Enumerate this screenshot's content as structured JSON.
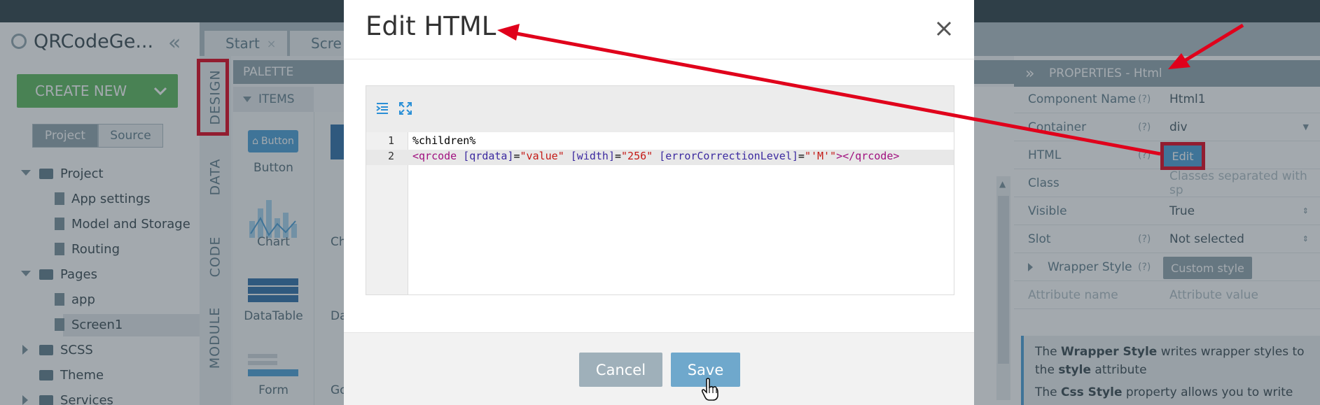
{
  "sidebar": {
    "project_name": "QRCodeGe...",
    "create_new_label": "CREATE NEW",
    "segments": [
      "Project",
      "Source"
    ],
    "tree": [
      {
        "label": "Project",
        "type": "folder"
      },
      {
        "label": "App settings",
        "type": "settings"
      },
      {
        "label": "Model and Storage",
        "type": "settings"
      },
      {
        "label": "Routing",
        "type": "settings"
      },
      {
        "label": "Pages",
        "type": "folder"
      },
      {
        "label": "app",
        "type": "page"
      },
      {
        "label": "Screen1",
        "type": "page"
      },
      {
        "label": "SCSS",
        "type": "folder"
      },
      {
        "label": "Theme",
        "type": "folder"
      },
      {
        "label": "Services",
        "type": "folder"
      }
    ]
  },
  "tabs": [
    "Start",
    "Scre"
  ],
  "side_tabs": [
    "DESIGN",
    "DATA",
    "CODE",
    "MODULE"
  ],
  "palette": {
    "title": "PALETTE",
    "section": "ITEMS",
    "items": [
      "Button",
      "Chart",
      "DataTable",
      "Form"
    ],
    "partial_items": [
      "Ch",
      "Da",
      "Goo"
    ],
    "button_preview": "Button"
  },
  "properties": {
    "title": "PROPERTIES - Html",
    "rows": [
      {
        "key": "Component Name",
        "help": "(?)",
        "value": "Html1"
      },
      {
        "key": "Container",
        "help": "(?)",
        "value": "div"
      },
      {
        "key": "HTML",
        "help": "(?)",
        "value": "Edit"
      },
      {
        "key": "Class",
        "help": "",
        "value": "Classes separated with sp"
      },
      {
        "key": "Visible",
        "help": "",
        "value": "True"
      },
      {
        "key": "Slot",
        "help": "(?)",
        "value": "Not selected"
      },
      {
        "key": "Wrapper Style",
        "help": "(?)",
        "value": "Custom style"
      },
      {
        "key": "Attribute name",
        "help": "",
        "value": "Attribute value"
      }
    ],
    "info_line1_pre": "The ",
    "info_line1_bold": "Wrapper Style",
    "info_line1_post": " writes wrapper styles to",
    "info_line2_pre": "the ",
    "info_line2_bold": "style",
    "info_line2_post": " attribute",
    "info_line3_pre": "The ",
    "info_line3_bold": "Css Style",
    "info_line3_post": " property allows you to write css"
  },
  "modal": {
    "title": "Edit HTML",
    "close": "×",
    "line_numbers": [
      "1",
      "2"
    ],
    "code_line1": "%children%",
    "code_line2": {
      "t1": "<qrcode ",
      "t2": "[qrdata]",
      "t3": "=",
      "t4": "\"value\"",
      "t5": " ",
      "t6": "[width]",
      "t7": "=",
      "t8": "\"256\"",
      "t9": " ",
      "t10": "[errorCorrectionLevel]",
      "t11": "=",
      "t12": "\"'M'\"",
      "t13": "></qrcode>"
    },
    "cancel_label": "Cancel",
    "save_label": "Save"
  },
  "colors": {
    "annotation_red": "#e0001b",
    "accent_blue": "#4a9fd8",
    "create_green": "#5cb85c"
  }
}
